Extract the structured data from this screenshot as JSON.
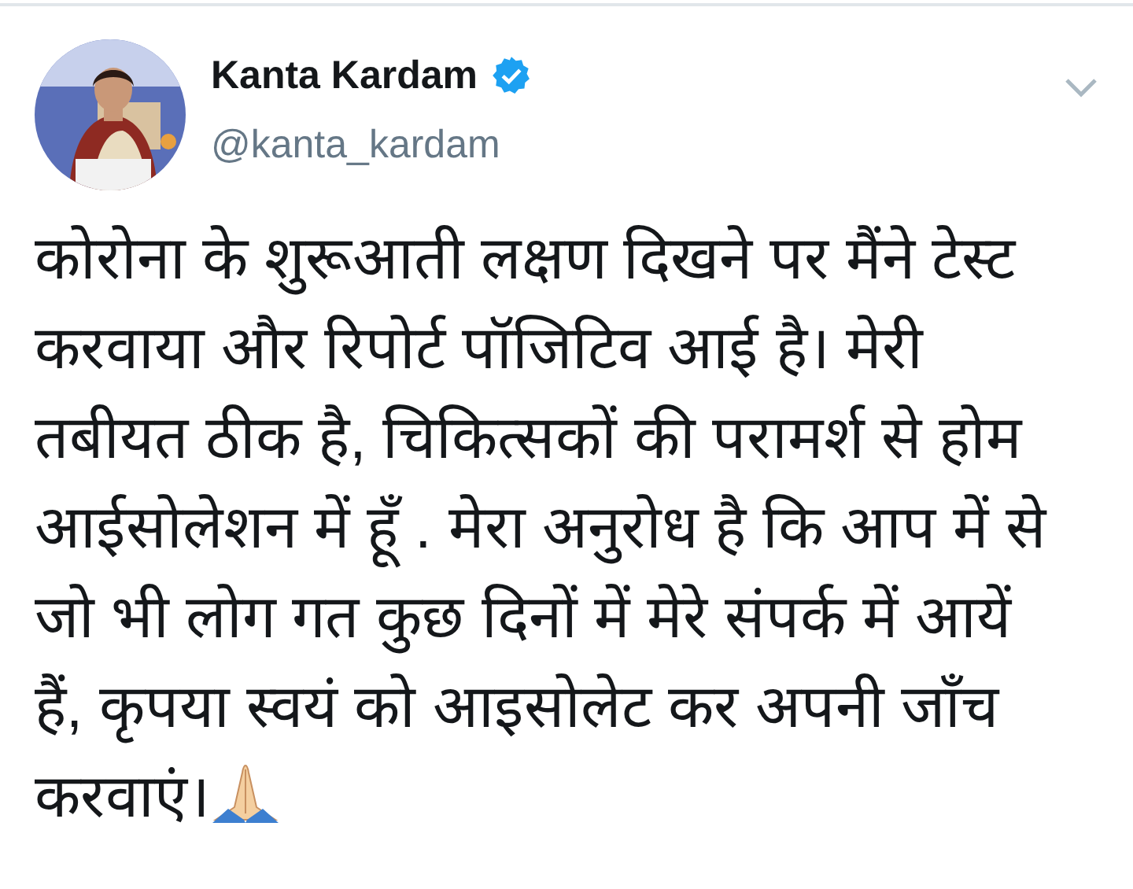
{
  "author": {
    "name": "Kanta Kardam",
    "handle": "@kanta_kardam",
    "verified": true
  },
  "text_lines": [
    "कोरोना के शुरूआती लक्षण दिखने पर मैंने टेस्ट",
    "करवाया और रिपोर्ट पॉजिटिव आई है। मेरी",
    "तबीयत ठीक है, चिकित्सकों की परामर्श से होम",
    "आईसोलेशन में हूँ . मेरा अनुरोध है कि आप में से",
    "जो भी लोग गत कुछ दिनों में मेरे संपर्क में आयें",
    "हैं, कृपया स्वयं को आइसोलेट कर अपनी जाँच",
    "करवाएं।"
  ]
}
